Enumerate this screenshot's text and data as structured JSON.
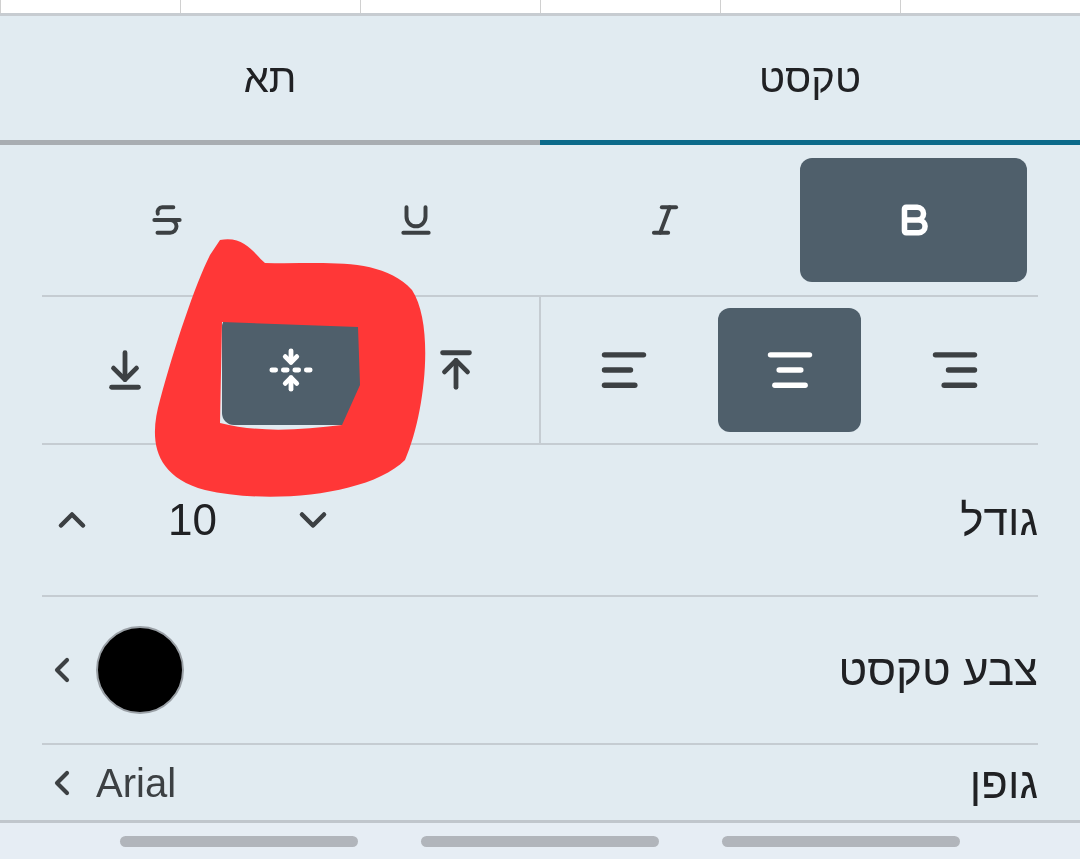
{
  "tabs": [
    {
      "label": "טקסט",
      "selected": true
    },
    {
      "label": "תא",
      "selected": false
    }
  ],
  "text_style": [
    {
      "kind": "bold",
      "selected": true
    },
    {
      "kind": "italic",
      "selected": false
    },
    {
      "kind": "underline",
      "selected": false
    },
    {
      "kind": "strikethrough",
      "selected": false
    }
  ],
  "horizontal_align": [
    {
      "kind": "right",
      "selected": false
    },
    {
      "kind": "center",
      "selected": true
    },
    {
      "kind": "left",
      "selected": false
    }
  ],
  "vertical_align": [
    {
      "kind": "top",
      "selected": false
    },
    {
      "kind": "middle",
      "selected": true
    },
    {
      "kind": "bottom",
      "selected": false
    }
  ],
  "size": {
    "label": "גודל",
    "value": "10"
  },
  "text_color": {
    "label": "צבע טקסט",
    "color": "#000000"
  },
  "font": {
    "label": "גופן",
    "value": "Arial"
  }
}
